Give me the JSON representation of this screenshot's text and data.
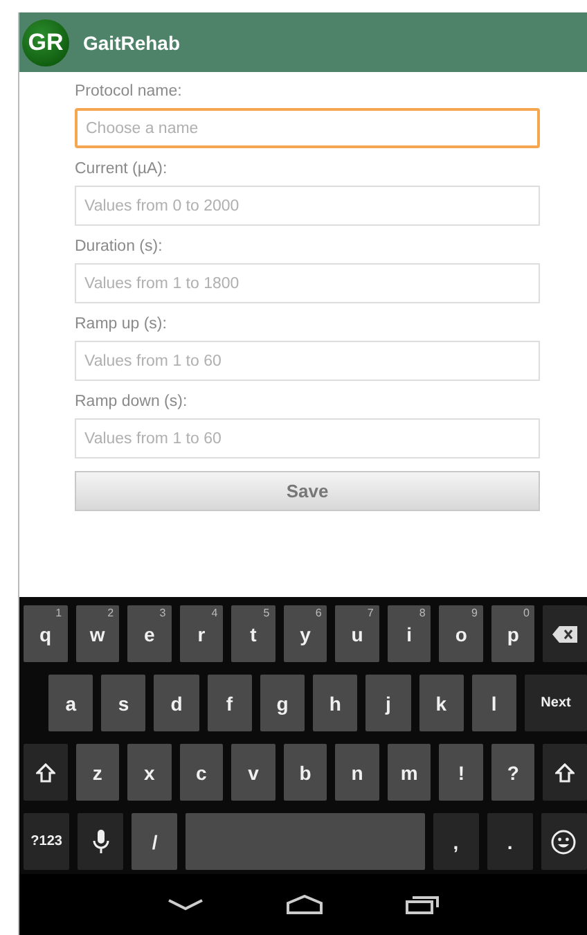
{
  "app_bar": {
    "logo": "GR",
    "title": "GaitRehab"
  },
  "form": {
    "fields": [
      {
        "label": "Protocol name:",
        "placeholder": "Choose a name",
        "focused": true
      },
      {
        "label": "Current (µA):",
        "placeholder": "Values from 0 to 2000",
        "focused": false
      },
      {
        "label": "Duration (s):",
        "placeholder": "Values from 1 to 1800",
        "focused": false
      },
      {
        "label": "Ramp up (s):",
        "placeholder": "Values from 1 to 60",
        "focused": false
      },
      {
        "label": "Ramp down (s):",
        "placeholder": "Values from 1 to 60",
        "focused": false
      }
    ],
    "save_button": "Save"
  },
  "keyboard": {
    "rows": [
      {
        "keys": [
          {
            "kind": "letter",
            "label": "q",
            "hint": "1"
          },
          {
            "kind": "letter",
            "label": "w",
            "hint": "2"
          },
          {
            "kind": "letter",
            "label": "e",
            "hint": "3"
          },
          {
            "kind": "letter",
            "label": "r",
            "hint": "4"
          },
          {
            "kind": "letter",
            "label": "t",
            "hint": "5"
          },
          {
            "kind": "letter",
            "label": "y",
            "hint": "6"
          },
          {
            "kind": "letter",
            "label": "u",
            "hint": "7"
          },
          {
            "kind": "letter",
            "label": "i",
            "hint": "8"
          },
          {
            "kind": "letter",
            "label": "o",
            "hint": "9"
          },
          {
            "kind": "letter",
            "label": "p",
            "hint": "0"
          },
          {
            "kind": "backspace"
          }
        ]
      },
      {
        "keys": [
          {
            "kind": "letter",
            "label": "a"
          },
          {
            "kind": "letter",
            "label": "s"
          },
          {
            "kind": "letter",
            "label": "d"
          },
          {
            "kind": "letter",
            "label": "f"
          },
          {
            "kind": "letter",
            "label": "g"
          },
          {
            "kind": "letter",
            "label": "h"
          },
          {
            "kind": "letter",
            "label": "j"
          },
          {
            "kind": "letter",
            "label": "k"
          },
          {
            "kind": "letter",
            "label": "l"
          },
          {
            "kind": "action",
            "label": "Next"
          }
        ]
      },
      {
        "keys": [
          {
            "kind": "shift"
          },
          {
            "kind": "letter",
            "label": "z"
          },
          {
            "kind": "letter",
            "label": "x"
          },
          {
            "kind": "letter",
            "label": "c"
          },
          {
            "kind": "letter",
            "label": "v"
          },
          {
            "kind": "letter",
            "label": "b"
          },
          {
            "kind": "letter",
            "label": "n"
          },
          {
            "kind": "letter",
            "label": "m"
          },
          {
            "kind": "letter",
            "label": "!"
          },
          {
            "kind": "letter",
            "label": "?"
          },
          {
            "kind": "shift"
          }
        ]
      },
      {
        "keys": [
          {
            "kind": "action",
            "label": "?123"
          },
          {
            "kind": "mic"
          },
          {
            "kind": "letter",
            "label": "/"
          },
          {
            "kind": "space"
          },
          {
            "kind": "action",
            "label": ","
          },
          {
            "kind": "action",
            "label": "."
          },
          {
            "kind": "emoji"
          }
        ]
      }
    ]
  },
  "nav_bar": {
    "buttons": [
      {
        "kind": "back"
      },
      {
        "kind": "home"
      },
      {
        "kind": "recents"
      }
    ]
  }
}
